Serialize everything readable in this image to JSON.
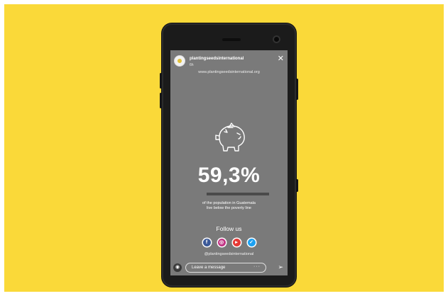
{
  "story": {
    "account": "plantingseedsinternational",
    "time": "6h",
    "url": "www.plantingseedsinternational.org",
    "percent": "59,3%",
    "description_line1": "of the population in Guatemala",
    "description_line2": "live below the poverty line",
    "follow_label": "Follow us",
    "socials": [
      {
        "name": "facebook-icon",
        "glyph": "f",
        "color": "#3b5998"
      },
      {
        "name": "instagram-icon",
        "glyph": "◎",
        "color": "#c13584"
      },
      {
        "name": "youtube-icon",
        "glyph": "▸",
        "color": "#e53935"
      },
      {
        "name": "twitter-icon",
        "glyph": "✓",
        "color": "#1da1f2"
      }
    ],
    "handle": "@plantingseedsinternational"
  },
  "reply_bar": {
    "placeholder": "Leave a message",
    "more_label": "···"
  },
  "colors": {
    "background": "#fad939",
    "screen": "#7a7a7a"
  }
}
